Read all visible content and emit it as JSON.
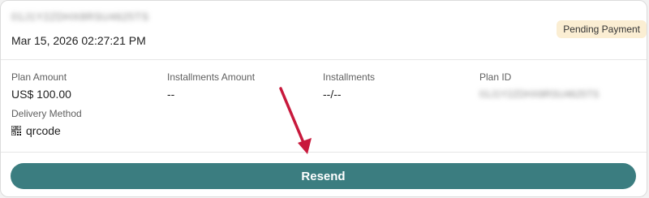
{
  "order": {
    "id_blurred": "01J1Y2ZDHX8RSU4625TS",
    "datetime": "Mar 15, 2026 02:27:21 PM",
    "status": "Pending Payment"
  },
  "details": {
    "plan_amount": {
      "label": "Plan Amount",
      "value": "US$ 100.00"
    },
    "installments_amount": {
      "label": "Installments Amount",
      "value": "--"
    },
    "installments": {
      "label": "Installments",
      "value": "--/--"
    },
    "plan_id": {
      "label": "Plan ID",
      "value": "01J1Y2ZDHX8RSU4625TS"
    },
    "delivery_method": {
      "label": "Delivery Method",
      "value": "qrcode",
      "icon": "qr-code-icon"
    }
  },
  "footer": {
    "resend_label": "Resend"
  },
  "colors": {
    "primary": "#3b7d80",
    "badge_bg": "#fbeed3",
    "annotation_arrow": "#c8193c"
  }
}
